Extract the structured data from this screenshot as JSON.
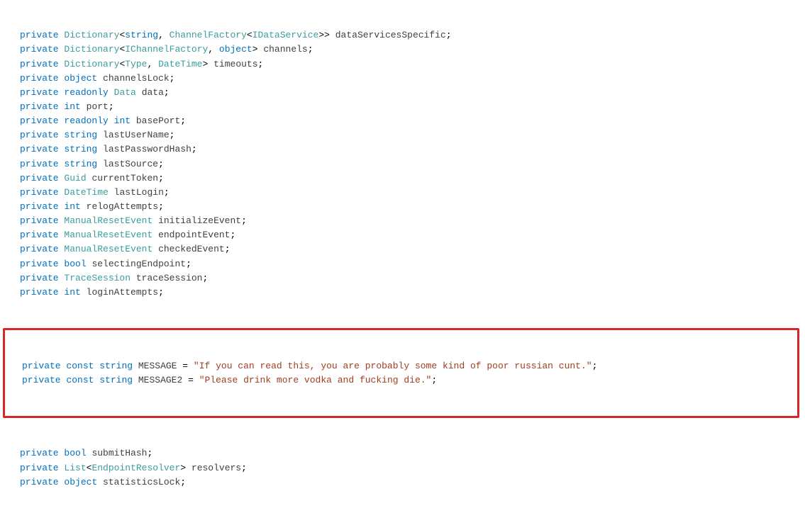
{
  "lines": [
    {
      "tokens": [
        {
          "t": "kw",
          "v": "private"
        },
        {
          "t": "punc",
          "v": " "
        },
        {
          "t": "type",
          "v": "Dictionary"
        },
        {
          "t": "punc",
          "v": "<"
        },
        {
          "t": "kw",
          "v": "string"
        },
        {
          "t": "punc",
          "v": ", "
        },
        {
          "t": "type",
          "v": "ChannelFactory"
        },
        {
          "t": "punc",
          "v": "<"
        },
        {
          "t": "type",
          "v": "IDataService"
        },
        {
          "t": "punc",
          "v": ">> "
        },
        {
          "t": "ident",
          "v": "dataServicesSpecific"
        },
        {
          "t": "punc",
          "v": ";"
        }
      ]
    },
    {
      "tokens": [
        {
          "t": "kw",
          "v": "private"
        },
        {
          "t": "punc",
          "v": " "
        },
        {
          "t": "type",
          "v": "Dictionary"
        },
        {
          "t": "punc",
          "v": "<"
        },
        {
          "t": "type",
          "v": "IChannelFactory"
        },
        {
          "t": "punc",
          "v": ", "
        },
        {
          "t": "kw",
          "v": "object"
        },
        {
          "t": "punc",
          "v": "> "
        },
        {
          "t": "ident",
          "v": "channels"
        },
        {
          "t": "punc",
          "v": ";"
        }
      ]
    },
    {
      "tokens": [
        {
          "t": "kw",
          "v": "private"
        },
        {
          "t": "punc",
          "v": " "
        },
        {
          "t": "type",
          "v": "Dictionary"
        },
        {
          "t": "punc",
          "v": "<"
        },
        {
          "t": "type",
          "v": "Type"
        },
        {
          "t": "punc",
          "v": ", "
        },
        {
          "t": "type",
          "v": "DateTime"
        },
        {
          "t": "punc",
          "v": "> "
        },
        {
          "t": "ident",
          "v": "timeouts"
        },
        {
          "t": "punc",
          "v": ";"
        }
      ]
    },
    {
      "tokens": [
        {
          "t": "kw",
          "v": "private"
        },
        {
          "t": "punc",
          "v": " "
        },
        {
          "t": "kw",
          "v": "object"
        },
        {
          "t": "punc",
          "v": " "
        },
        {
          "t": "ident",
          "v": "channelsLock"
        },
        {
          "t": "punc",
          "v": ";"
        }
      ]
    },
    {
      "tokens": [
        {
          "t": "kw",
          "v": "private"
        },
        {
          "t": "punc",
          "v": " "
        },
        {
          "t": "kw",
          "v": "readonly"
        },
        {
          "t": "punc",
          "v": " "
        },
        {
          "t": "type",
          "v": "Data"
        },
        {
          "t": "punc",
          "v": " "
        },
        {
          "t": "ident",
          "v": "data"
        },
        {
          "t": "punc",
          "v": ";"
        }
      ]
    },
    {
      "tokens": [
        {
          "t": "kw",
          "v": "private"
        },
        {
          "t": "punc",
          "v": " "
        },
        {
          "t": "kw",
          "v": "int"
        },
        {
          "t": "punc",
          "v": " "
        },
        {
          "t": "ident",
          "v": "port"
        },
        {
          "t": "punc",
          "v": ";"
        }
      ]
    },
    {
      "tokens": [
        {
          "t": "kw",
          "v": "private"
        },
        {
          "t": "punc",
          "v": " "
        },
        {
          "t": "kw",
          "v": "readonly"
        },
        {
          "t": "punc",
          "v": " "
        },
        {
          "t": "kw",
          "v": "int"
        },
        {
          "t": "punc",
          "v": " "
        },
        {
          "t": "ident",
          "v": "basePort"
        },
        {
          "t": "punc",
          "v": ";"
        }
      ]
    },
    {
      "tokens": [
        {
          "t": "kw",
          "v": "private"
        },
        {
          "t": "punc",
          "v": " "
        },
        {
          "t": "kw",
          "v": "string"
        },
        {
          "t": "punc",
          "v": " "
        },
        {
          "t": "ident",
          "v": "lastUserName"
        },
        {
          "t": "punc",
          "v": ";"
        }
      ]
    },
    {
      "tokens": [
        {
          "t": "kw",
          "v": "private"
        },
        {
          "t": "punc",
          "v": " "
        },
        {
          "t": "kw",
          "v": "string"
        },
        {
          "t": "punc",
          "v": " "
        },
        {
          "t": "ident",
          "v": "lastPasswordHash"
        },
        {
          "t": "punc",
          "v": ";"
        }
      ]
    },
    {
      "tokens": [
        {
          "t": "kw",
          "v": "private"
        },
        {
          "t": "punc",
          "v": " "
        },
        {
          "t": "kw",
          "v": "string"
        },
        {
          "t": "punc",
          "v": " "
        },
        {
          "t": "ident",
          "v": "lastSource"
        },
        {
          "t": "punc",
          "v": ";"
        }
      ]
    },
    {
      "tokens": [
        {
          "t": "kw",
          "v": "private"
        },
        {
          "t": "punc",
          "v": " "
        },
        {
          "t": "type",
          "v": "Guid"
        },
        {
          "t": "punc",
          "v": " "
        },
        {
          "t": "ident",
          "v": "currentToken"
        },
        {
          "t": "punc",
          "v": ";"
        }
      ]
    },
    {
      "tokens": [
        {
          "t": "kw",
          "v": "private"
        },
        {
          "t": "punc",
          "v": " "
        },
        {
          "t": "type",
          "v": "DateTime"
        },
        {
          "t": "punc",
          "v": " "
        },
        {
          "t": "ident",
          "v": "lastLogin"
        },
        {
          "t": "punc",
          "v": ";"
        }
      ]
    },
    {
      "tokens": [
        {
          "t": "kw",
          "v": "private"
        },
        {
          "t": "punc",
          "v": " "
        },
        {
          "t": "kw",
          "v": "int"
        },
        {
          "t": "punc",
          "v": " "
        },
        {
          "t": "ident",
          "v": "relogAttempts"
        },
        {
          "t": "punc",
          "v": ";"
        }
      ]
    },
    {
      "tokens": [
        {
          "t": "kw",
          "v": "private"
        },
        {
          "t": "punc",
          "v": " "
        },
        {
          "t": "type",
          "v": "ManualResetEvent"
        },
        {
          "t": "punc",
          "v": " "
        },
        {
          "t": "ident",
          "v": "initializeEvent"
        },
        {
          "t": "punc",
          "v": ";"
        }
      ]
    },
    {
      "tokens": [
        {
          "t": "kw",
          "v": "private"
        },
        {
          "t": "punc",
          "v": " "
        },
        {
          "t": "type",
          "v": "ManualResetEvent"
        },
        {
          "t": "punc",
          "v": " "
        },
        {
          "t": "ident",
          "v": "endpointEvent"
        },
        {
          "t": "punc",
          "v": ";"
        }
      ]
    },
    {
      "tokens": [
        {
          "t": "kw",
          "v": "private"
        },
        {
          "t": "punc",
          "v": " "
        },
        {
          "t": "type",
          "v": "ManualResetEvent"
        },
        {
          "t": "punc",
          "v": " "
        },
        {
          "t": "ident",
          "v": "checkedEvent"
        },
        {
          "t": "punc",
          "v": ";"
        }
      ]
    },
    {
      "tokens": [
        {
          "t": "kw",
          "v": "private"
        },
        {
          "t": "punc",
          "v": " "
        },
        {
          "t": "kw",
          "v": "bool"
        },
        {
          "t": "punc",
          "v": " "
        },
        {
          "t": "ident",
          "v": "selectingEndpoint"
        },
        {
          "t": "punc",
          "v": ";"
        }
      ]
    },
    {
      "tokens": [
        {
          "t": "kw",
          "v": "private"
        },
        {
          "t": "punc",
          "v": " "
        },
        {
          "t": "type",
          "v": "TraceSession"
        },
        {
          "t": "punc",
          "v": " "
        },
        {
          "t": "ident",
          "v": "traceSession"
        },
        {
          "t": "punc",
          "v": ";"
        }
      ]
    },
    {
      "tokens": [
        {
          "t": "kw",
          "v": "private"
        },
        {
          "t": "punc",
          "v": " "
        },
        {
          "t": "kw",
          "v": "int"
        },
        {
          "t": "punc",
          "v": " "
        },
        {
          "t": "ident",
          "v": "loginAttempts"
        },
        {
          "t": "punc",
          "v": ";"
        }
      ]
    }
  ],
  "highlight_lines": [
    {
      "tokens": [
        {
          "t": "kw",
          "v": "private"
        },
        {
          "t": "punc",
          "v": " "
        },
        {
          "t": "kw",
          "v": "const"
        },
        {
          "t": "punc",
          "v": " "
        },
        {
          "t": "kw",
          "v": "string"
        },
        {
          "t": "punc",
          "v": " "
        },
        {
          "t": "ident",
          "v": "MESSAGE"
        },
        {
          "t": "punc",
          "v": " = "
        },
        {
          "t": "str",
          "v": "\"If you can read this, you are probably some kind of poor russian cunt.\""
        },
        {
          "t": "punc",
          "v": ";"
        }
      ]
    },
    {
      "tokens": [
        {
          "t": "kw",
          "v": "private"
        },
        {
          "t": "punc",
          "v": " "
        },
        {
          "t": "kw",
          "v": "const"
        },
        {
          "t": "punc",
          "v": " "
        },
        {
          "t": "kw",
          "v": "string"
        },
        {
          "t": "punc",
          "v": " "
        },
        {
          "t": "ident",
          "v": "MESSAGE2"
        },
        {
          "t": "punc",
          "v": " = "
        },
        {
          "t": "str",
          "v": "\"Please drink more vodka and fucking die.\""
        },
        {
          "t": "punc",
          "v": ";"
        }
      ]
    }
  ],
  "after_lines": [
    {
      "tokens": [
        {
          "t": "kw",
          "v": "private"
        },
        {
          "t": "punc",
          "v": " "
        },
        {
          "t": "kw",
          "v": "bool"
        },
        {
          "t": "punc",
          "v": " "
        },
        {
          "t": "ident",
          "v": "submitHash"
        },
        {
          "t": "punc",
          "v": ";"
        }
      ]
    },
    {
      "tokens": [
        {
          "t": "kw",
          "v": "private"
        },
        {
          "t": "punc",
          "v": " "
        },
        {
          "t": "type",
          "v": "List"
        },
        {
          "t": "punc",
          "v": "<"
        },
        {
          "t": "type",
          "v": "EndpointResolver"
        },
        {
          "t": "punc",
          "v": "> "
        },
        {
          "t": "ident",
          "v": "resolvers"
        },
        {
          "t": "punc",
          "v": ";"
        }
      ]
    },
    {
      "tokens": [
        {
          "t": "kw",
          "v": "private"
        },
        {
          "t": "punc",
          "v": " "
        },
        {
          "t": "kw",
          "v": "object"
        },
        {
          "t": "punc",
          "v": " "
        },
        {
          "t": "ident",
          "v": "statisticsLock"
        },
        {
          "t": "punc",
          "v": ";"
        }
      ]
    }
  ]
}
